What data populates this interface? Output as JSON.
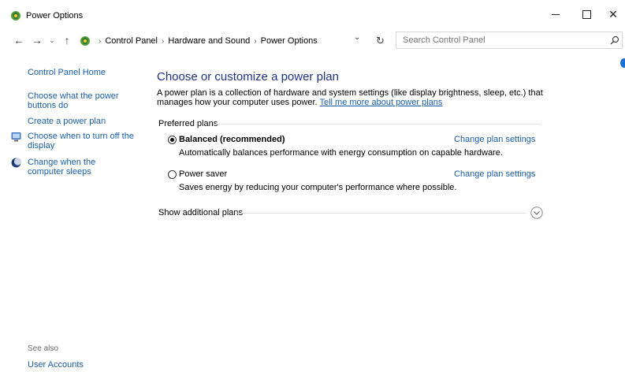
{
  "window": {
    "title": "Power Options",
    "app_icon": "power-options-icon",
    "controls": {
      "minimize": "—",
      "maximize": "□",
      "close": "✕"
    }
  },
  "nav": {
    "back": "←",
    "forward": "→",
    "recent": "⌄",
    "up": "↑",
    "breadcrumbs": [
      "Control Panel",
      "Hardware and Sound",
      "Power Options"
    ],
    "dropdown": "⌄",
    "refresh": "↻"
  },
  "search": {
    "placeholder": "Search Control Panel"
  },
  "sidebar": {
    "home": "Control Panel Home",
    "links": [
      {
        "label": "Choose what the power buttons do"
      },
      {
        "label": "Create a power plan"
      },
      {
        "label": "Choose when to turn off the display",
        "icon": "display-icon"
      },
      {
        "label": "Change when the computer sleeps",
        "icon": "sleep-moon-icon"
      }
    ],
    "see_also_label": "See also",
    "see_also": [
      {
        "label": "User Accounts"
      }
    ]
  },
  "main": {
    "heading": "Choose or customize a power plan",
    "intro_text": "A power plan is a collection of hardware and system settings (like display brightness, sleep, etc.) that manages how your computer uses power. ",
    "intro_link": "Tell me more about power plans",
    "preferred_label": "Preferred plans",
    "plans": [
      {
        "name": "Balanced (recommended)",
        "description": "Automatically balances performance with energy consumption on capable hardware.",
        "change_link": "Change plan settings",
        "selected": true
      },
      {
        "name": "Power saver",
        "description": "Saves energy by reducing your computer's performance where possible.",
        "change_link": "Change plan settings",
        "selected": false
      }
    ],
    "show_additional": "Show additional plans"
  },
  "colors": {
    "link": "#1a5ea8",
    "heading": "#1e3287",
    "divider": "#e1e1e1"
  }
}
